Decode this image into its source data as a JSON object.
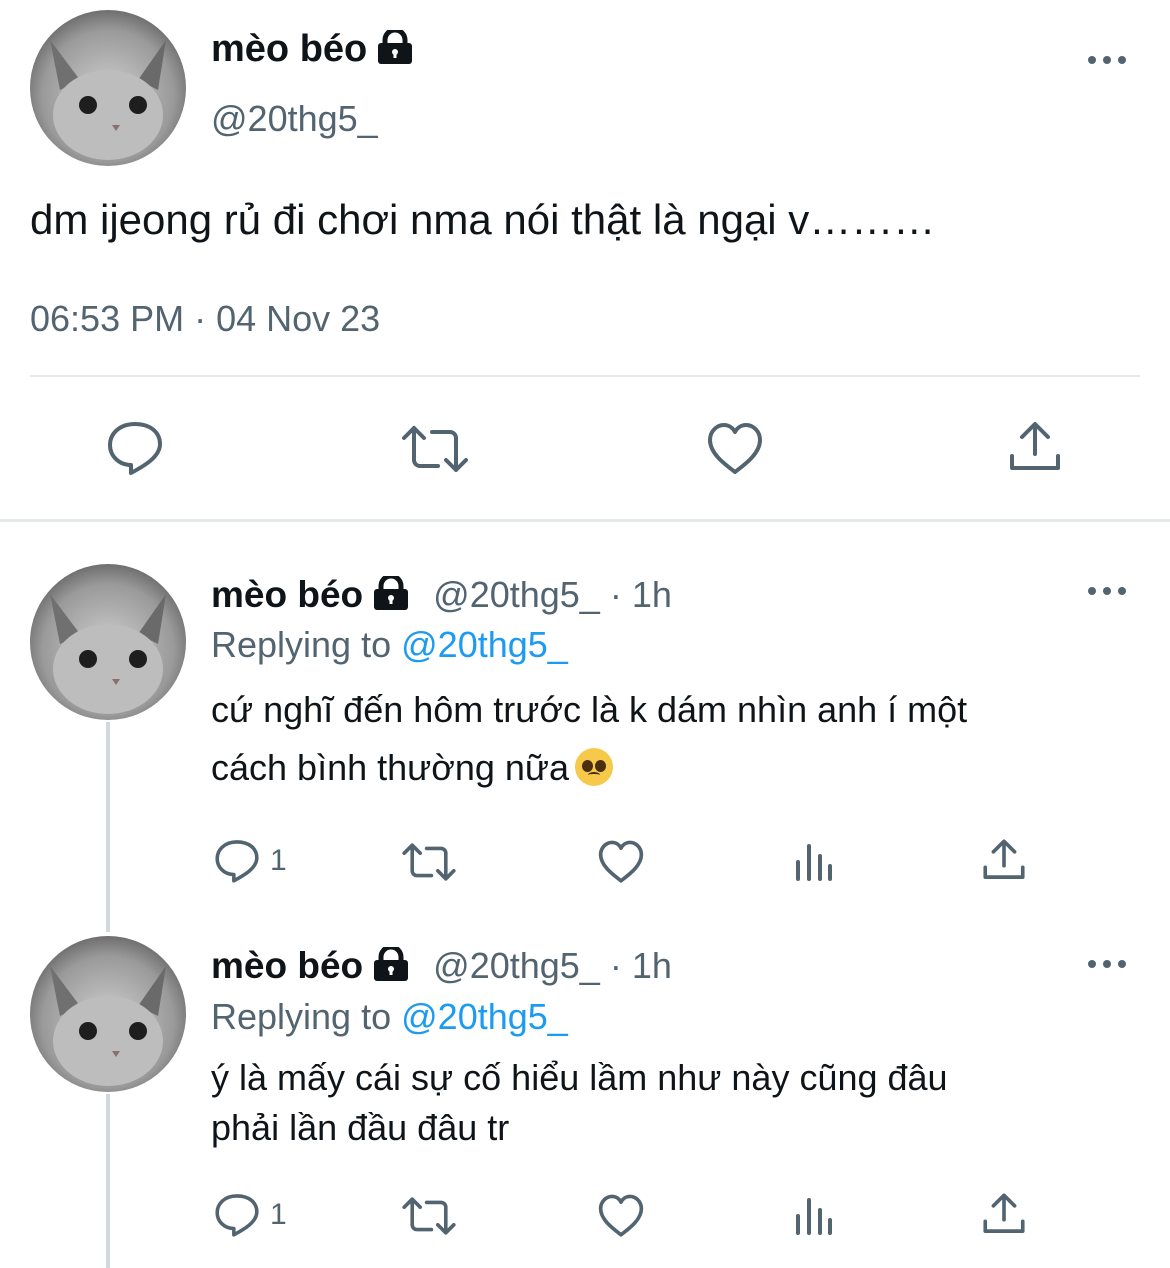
{
  "main_tweet": {
    "display_name": "mèo béo",
    "handle": "@20thg5_",
    "text": "dm ijeong rủ đi chơi nma nói thật là ngại v………",
    "timestamp": "06:53 PM · 04 Nov 23"
  },
  "replies": [
    {
      "display_name": "mèo béo",
      "handle_time": "@20thg5_ · 1h",
      "replying_prefix": "Replying to",
      "replying_mention": "@20thg5_",
      "text_line1": "cứ nghĩ đến hôm trước là k dám nhìn anh í một",
      "text_line2": "cách bình thường nữa",
      "emoji": "pleading-face",
      "reply_count": "1"
    },
    {
      "display_name": "mèo béo",
      "handle_time": "@20thg5_ · 1h",
      "replying_prefix": "Replying to",
      "replying_mention": "@20thg5_",
      "text_line1": "ý là mấy cái sự cố hiểu lầm như này cũng đâu",
      "text_line2": "phải lần đầu đâu tr",
      "reply_count": "1"
    }
  ],
  "colors": {
    "text": "#0f1419",
    "secondary": "#536471",
    "link": "#1d9bf0",
    "divider": "#e6e9ea"
  }
}
